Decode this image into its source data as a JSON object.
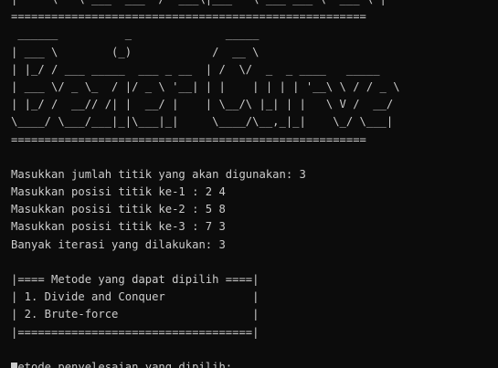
{
  "terminal": {
    "lines": [
      "|     \\   \\ ___  ___  /  ___\\|___   \\ ___ ___ \\  ___ \\ |",
      "=====================================================",
      " ______          _              _____",
      "| ___ \\        (_)            /  __ \\",
      "| |_/ / ___ _____  ___ _ __  | /  \\/  _  _ ____   _____",
      "| ___ \\/ _ \\_  / |/ _ \\ '__| | |    | | | | '__\\ \\ / / _ \\",
      "| |_/ /  __// /| |  __/ |    | \\__/\\ |_| | |   \\ V /  __/",
      "\\____/ \\___/___|_|\\___|_|     \\____/\\__,_|_|    \\_/ \\___|",
      "=====================================================",
      "",
      "Masukkan jumlah titik yang akan digunakan: 3",
      "Masukkan posisi titik ke-1 : 2 4",
      "Masukkan posisi titik ke-2 : 5 8",
      "Masukkan posisi titik ke-3 : 7 3",
      "Banyak iterasi yang dilakukan: 3",
      "",
      "|==== Metode yang dapat dipilih ====|",
      "| 1. Divide and Conquer             |",
      "| 2. Brute-force                    |",
      "|===================================|",
      "",
      "Metode penyelesaian yang dipilih: "
    ]
  }
}
